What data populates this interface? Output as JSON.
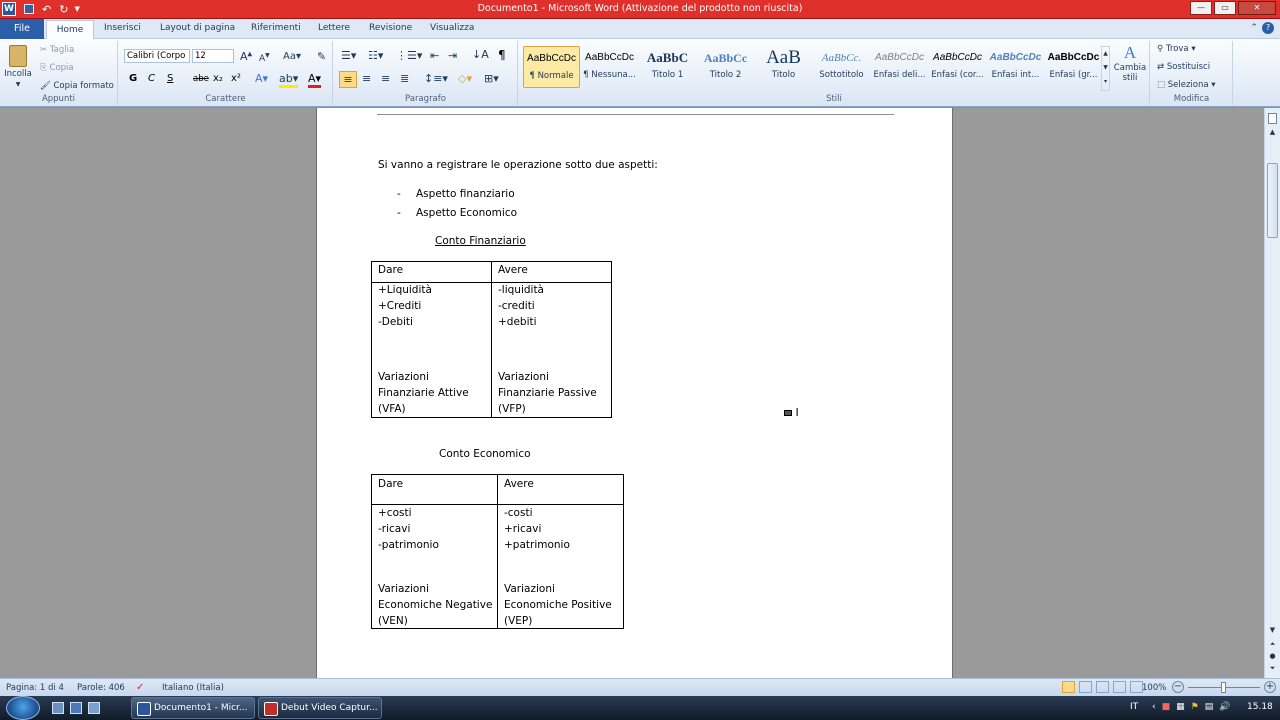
{
  "window": {
    "title": "Documento1  -  Microsoft Word (Attivazione del prodotto non riuscita)",
    "app_icon": "word-icon"
  },
  "tabs": [
    "File",
    "Home",
    "Inserisci",
    "Layout di pagina",
    "Riferimenti",
    "Lettere",
    "Revisione",
    "Visualizza"
  ],
  "ribbon": {
    "clipboard": {
      "paste": "Incolla",
      "cut": "Taglia",
      "copy": "Copia",
      "format_painter": "Copia formato",
      "group": "Appunti"
    },
    "font": {
      "name": "Calibri (Corpo",
      "size": "12",
      "group": "Carattere",
      "bold": "G",
      "italic": "C",
      "underline": "S",
      "strike": "abe",
      "sub": "x₂",
      "sup": "x²"
    },
    "paragraph": {
      "group": "Paragrafo"
    },
    "styles": {
      "group": "Stili",
      "change": "Cambia stili",
      "items": [
        {
          "preview": "AaBbCcDc",
          "name": "¶ Normale"
        },
        {
          "preview": "AaBbCcDc",
          "name": "¶ Nessuna..."
        },
        {
          "preview": "AaBbC",
          "name": "Titolo 1"
        },
        {
          "preview": "AaBbCc",
          "name": "Titolo 2"
        },
        {
          "preview": "AaB",
          "name": "Titolo"
        },
        {
          "preview": "AaBbCc.",
          "name": "Sottotitolo"
        },
        {
          "preview": "AaBbCcDc",
          "name": "Enfasi deli..."
        },
        {
          "preview": "AaBbCcDc",
          "name": "Enfasi (cor..."
        },
        {
          "preview": "AaBbCcDc",
          "name": "Enfasi int..."
        },
        {
          "preview": "AaBbCcDc",
          "name": "Enfasi (gr..."
        }
      ]
    },
    "editing": {
      "find": "Trova",
      "replace": "Sostituisci",
      "select": "Seleziona",
      "group": "Modifica"
    }
  },
  "document": {
    "intro": "Si vanno a registrare le operazione sotto  due aspetti:",
    "bullets": [
      "Aspetto  finanziario",
      "Aspetto  Economico"
    ],
    "bullet_marker": "-",
    "finanziario": {
      "title": "Conto Finanziario",
      "dare": "Dare",
      "avere": "Avere",
      "dare_items": "+Liquidità\n+Crediti\n-Debiti",
      "avere_items": "-liquidità\n-crediti\n+debiti",
      "dare_total": "Variazioni\nFinanziarie Attive\n(VFA)",
      "avere_total": "Variazioni\nFinanziarie Passive\n(VFP)"
    },
    "economico": {
      "title": "Conto Economico",
      "dare": "Dare",
      "avere": "Avere",
      "dare_items": "+costi\n-ricavi\n-patrimonio",
      "avere_items": "-costi\n+ricavi\n+patrimonio",
      "dare_total": "Variazioni\nEconomiche Negative\n(VEN)",
      "avere_total": "Variazioni\nEconomiche Positive\n(VEP)"
    }
  },
  "status": {
    "page": "Pagina: 1 di 4",
    "words": "Parole: 406",
    "language": "Italiano (Italia)",
    "zoom": "100%",
    "zoom_level": 100
  },
  "taskbar": {
    "items": [
      "Documento1 - Micr...",
      "Debut Video Captur..."
    ],
    "lang": "IT",
    "time": "15.18"
  }
}
